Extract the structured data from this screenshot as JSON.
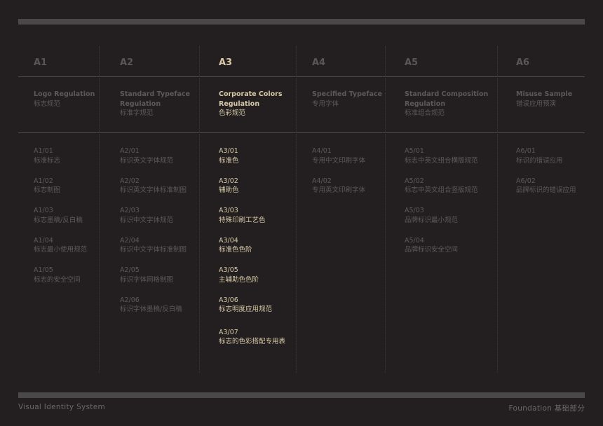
{
  "columns": [
    {
      "code": "A1",
      "title_en": "Logo Regulation",
      "title_cn": "标志规范",
      "active": false,
      "items": [
        {
          "code": "A1/01",
          "label": "标准标志"
        },
        {
          "code": "A1/02",
          "label": "标志制图"
        },
        {
          "code": "A1/03",
          "label": "标志墨稿/反白稿"
        },
        {
          "code": "A1/04",
          "label": "标志最小使用规范"
        },
        {
          "code": "A1/05",
          "label": "标志的安全空间"
        }
      ]
    },
    {
      "code": "A2",
      "title_en": "Standard Typeface Regulation",
      "title_cn": "标准字规范",
      "active": false,
      "items": [
        {
          "code": "A2/01",
          "label": "标识英文字体规范"
        },
        {
          "code": "A2/02",
          "label": "标识英文字体标准制图"
        },
        {
          "code": "A2/03",
          "label": "标识中文字体规范"
        },
        {
          "code": "A2/04",
          "label": "标识中文字体标准制图"
        },
        {
          "code": "A2/05",
          "label": "标识字体网格制图"
        },
        {
          "code": "A2/06",
          "label": "标识字体墨稿/反白稿"
        }
      ]
    },
    {
      "code": "A3",
      "title_en": "Corporate Colors Regulation",
      "title_cn": "色彩规范",
      "active": true,
      "items": [
        {
          "code": "A3/01",
          "label": "标准色"
        },
        {
          "code": "A3/02",
          "label": "辅助色"
        },
        {
          "code": "A3/03",
          "label": "特殊印刷工艺色"
        },
        {
          "code": "A3/04",
          "label": "标准色色阶"
        },
        {
          "code": "A3/05",
          "label": "主辅助色色阶"
        },
        {
          "code": "A3/06",
          "label": "标志明度应用规范"
        },
        {
          "code": "A3/07",
          "label": "标志的色彩搭配专用表"
        }
      ]
    },
    {
      "code": "A4",
      "title_en": "Specified Typeface",
      "title_cn": "专用字体",
      "active": false,
      "items": [
        {
          "code": "A4/01",
          "label": "专用中文印刷字体"
        },
        {
          "code": "A4/02",
          "label": "专用英文印刷字体"
        }
      ]
    },
    {
      "code": "A5",
      "title_en": "Standard Composition Regulation",
      "title_cn": "标准组合规范",
      "active": false,
      "items": [
        {
          "code": "A5/01",
          "label": "标志中英文组合横版规范"
        },
        {
          "code": "A5/02",
          "label": "标志中英文组合竖版规范"
        },
        {
          "code": "A5/03",
          "label": "品牌标识最小规范"
        },
        {
          "code": "A5/04",
          "label": "品牌标识安全空间"
        }
      ]
    },
    {
      "code": "A6",
      "title_en": "Misuse Sample",
      "title_cn": "错误应用预演",
      "active": false,
      "items": [
        {
          "code": "A6/01",
          "label": "标识的错误应用"
        },
        {
          "code": "A6/02",
          "label": "品牌标识的错误应用"
        }
      ]
    }
  ],
  "footer": {
    "left": "Visual Identity System",
    "right": "Foundation 基础部分"
  },
  "colors": {
    "background": "#231f20",
    "active_text": "#d7c9a7",
    "inactive_text": "#5d595a",
    "bar": "#4b4849"
  }
}
